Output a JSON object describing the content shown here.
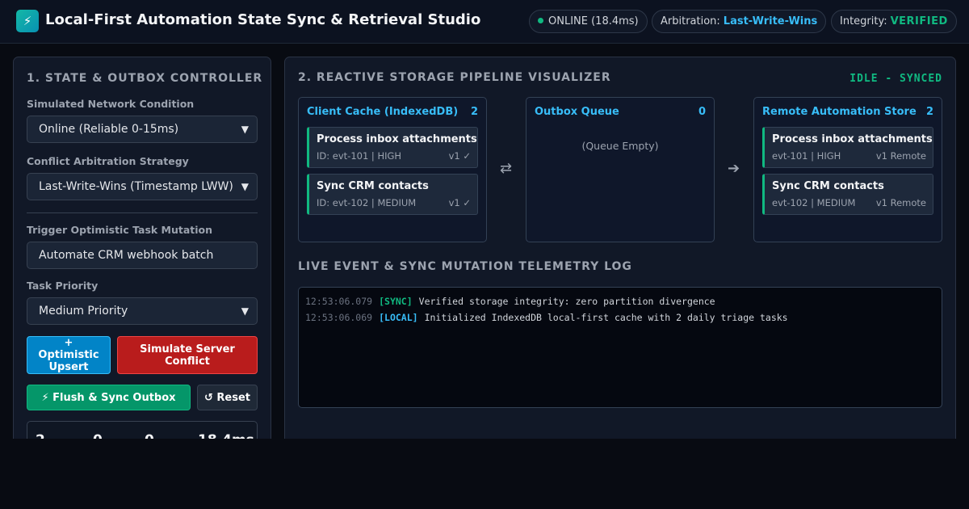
{
  "header": {
    "logo_glyph": "⚡",
    "title": "Local-First Automation State Sync & Retrieval Studio",
    "online_status": "ONLINE (18.4ms)",
    "arbitration_label": "Arbitration:",
    "arbitration_value": "Last-Write-Wins",
    "integrity_label": "Integrity:",
    "integrity_value": "VERIFIED"
  },
  "controller": {
    "title": "1. STATE & OUTBOX CONTROLLER",
    "network_label": "Simulated Network Condition",
    "network_value": "Online (Reliable 0-15ms)",
    "strategy_label": "Conflict Arbitration Strategy",
    "strategy_value": "Last-Write-Wins (Timestamp LWW)",
    "mutation_label": "Trigger Optimistic Task Mutation",
    "mutation_value": "Automate CRM webhook batch",
    "priority_label": "Task Priority",
    "priority_value": "Medium Priority",
    "upsert_button": "+ Optimistic Upsert",
    "conflict_button": "Simulate Server Conflict",
    "flush_button": "⚡ Flush & Sync Outbox",
    "reset_button": "↺ Reset",
    "stats": [
      "2",
      "0",
      "0",
      "18.4ms"
    ]
  },
  "pipeline": {
    "title": "2. REACTIVE STORAGE PIPELINE VISUALIZER",
    "status": "IDLE - SYNCED",
    "client_cache": {
      "title": "Client Cache (IndexedDB)",
      "count": "2",
      "items": [
        {
          "title": "Process inbox attachments",
          "meta": "ID: evt-101 | HIGH",
          "version": "v1 ✓"
        },
        {
          "title": "Sync CRM contacts",
          "meta": "ID: evt-102 | MEDIUM",
          "version": "v1 ✓"
        }
      ]
    },
    "outbox": {
      "title": "Outbox Queue",
      "count": "0",
      "empty_text": "(Queue Empty)"
    },
    "remote": {
      "title": "Remote Automation Store",
      "count": "2",
      "items": [
        {
          "title": "Process inbox attachments",
          "meta": "evt-101 | HIGH",
          "version": "v1 Remote"
        },
        {
          "title": "Sync CRM contacts",
          "meta": "evt-102 | MEDIUM",
          "version": "v1 Remote"
        }
      ]
    },
    "arrow_left": "⇄",
    "arrow_right": "➔"
  },
  "telemetry": {
    "title": "LIVE EVENT & SYNC MUTATION TELEMETRY LOG",
    "entries": [
      {
        "time": "12:53:06.079",
        "tag": "[SYNC]",
        "message": "Verified storage integrity: zero partition divergence"
      },
      {
        "time": "12:53:06.069",
        "tag": "[LOCAL]",
        "message": "Initialized IndexedDB local-first cache with 2 daily triage tasks"
      }
    ]
  },
  "colors": {
    "accent_blue": "#38bdf8",
    "accent_green": "#10b981",
    "danger_red": "#b91c1c",
    "background": "#080b12"
  }
}
